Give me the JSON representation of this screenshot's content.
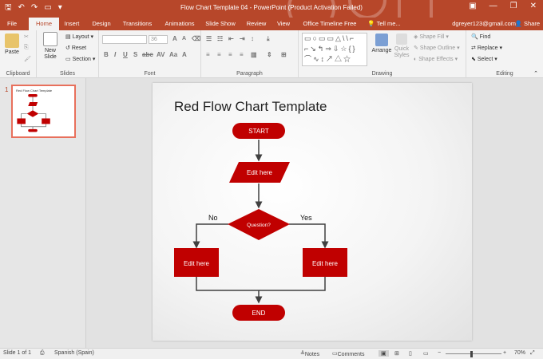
{
  "window": {
    "title": "Flow Chart Template 04 - PowerPoint (Product Activation Failed)",
    "minimize": "—",
    "restore": "❐",
    "close": "✕"
  },
  "qat": {
    "save_icon": "save-icon",
    "undo_icon": "undo-icon",
    "redo_icon": "redo-icon",
    "slideshow_icon": "present-icon"
  },
  "tabs": [
    {
      "label": "File"
    },
    {
      "label": "Home"
    },
    {
      "label": "Insert"
    },
    {
      "label": "Design"
    },
    {
      "label": "Transitions"
    },
    {
      "label": "Animations"
    },
    {
      "label": "Slide Show"
    },
    {
      "label": "Review"
    },
    {
      "label": "View"
    },
    {
      "label": "Office Timeline Free"
    },
    {
      "label": "Tell me..."
    }
  ],
  "account": {
    "user": "dgreyer123@gmail.com",
    "share": "Share"
  },
  "ribbon": {
    "clipboard": {
      "paste": "Paste",
      "label": "Clipboard"
    },
    "slides": {
      "new_slide": "New Slide",
      "layout": "Layout",
      "reset": "Reset",
      "section": "Section",
      "label": "Slides"
    },
    "font": {
      "font_size": "36",
      "label": "Font"
    },
    "paragraph": {
      "label": "Paragraph"
    },
    "drawing": {
      "arrange": "Arrange",
      "quick_styles": "Quick Styles",
      "shape_fill": "Shape Fill",
      "shape_outline": "Shape Outline",
      "shape_effects": "Shape Effects",
      "label": "Drawing"
    },
    "editing": {
      "find": "Find",
      "replace": "Replace",
      "select": "Select",
      "label": "Editing"
    }
  },
  "thumbnail": {
    "number": "1",
    "title": "Red Flow Chart Template"
  },
  "slide": {
    "title": "Red Flow Chart Template",
    "start": "START",
    "input": "Edit here",
    "decision": "Question?",
    "no_label": "No",
    "yes_label": "Yes",
    "left_process": "Edit here",
    "right_process": "Edit here",
    "end": "END"
  },
  "colors": {
    "accent": "#b7472a",
    "shape_red": "#c00000",
    "connector": "#404040"
  },
  "status": {
    "slide_info": "Slide 1 of 1",
    "language": "Spanish (Spain)",
    "notes": "Notes",
    "comments": "Comments",
    "zoom": "70%"
  }
}
